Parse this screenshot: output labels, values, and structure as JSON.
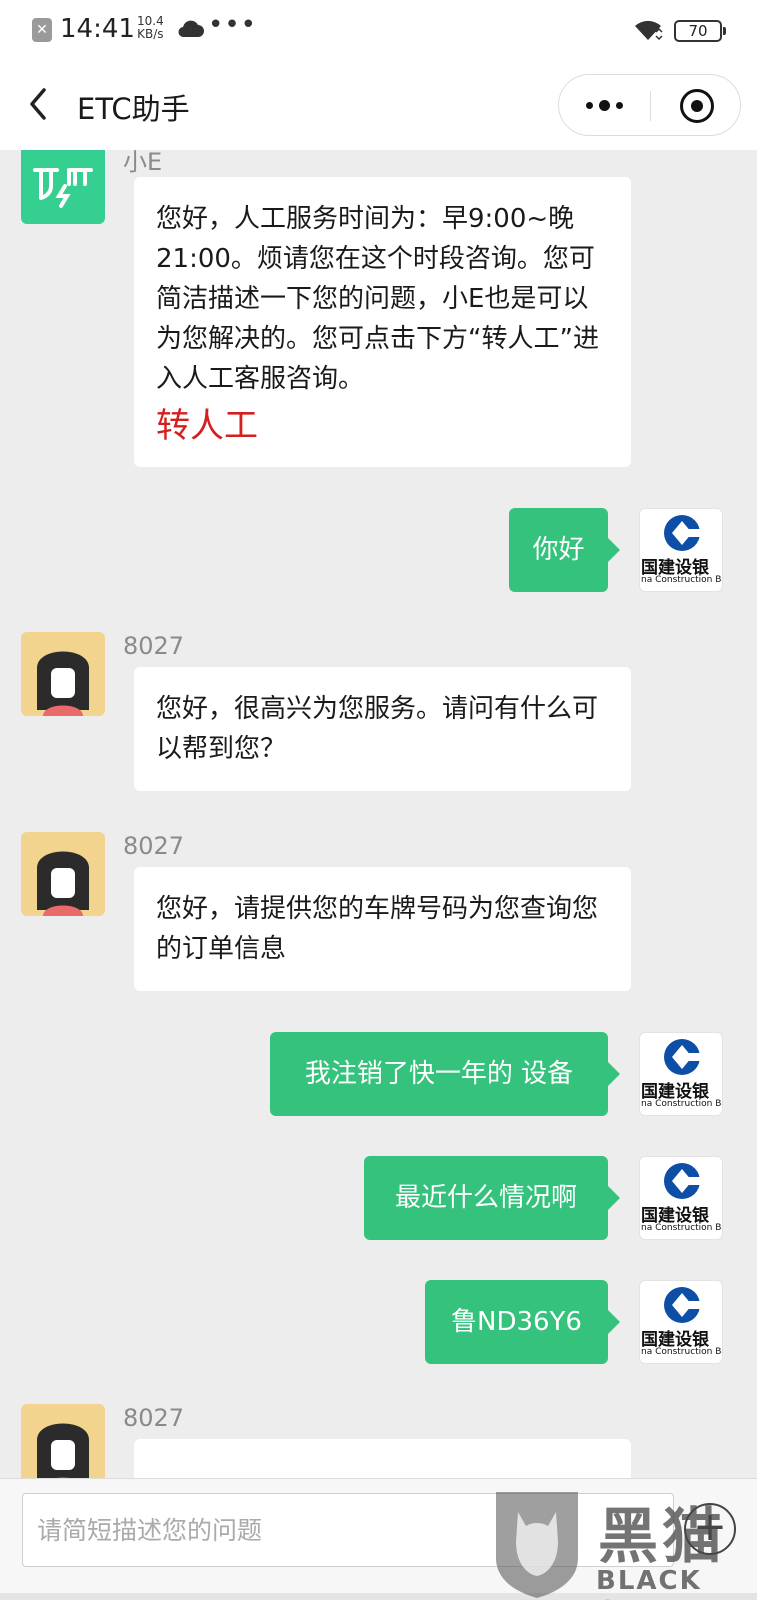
{
  "status_bar": {
    "time": "14:41",
    "net_speed_value": "10.4",
    "net_speed_unit": "KB/s",
    "more": "•••",
    "battery": "70",
    "icons": [
      "close-notification-icon",
      "cloud-icon",
      "wifi-icon",
      "battery-icon"
    ]
  },
  "nav": {
    "back_icon": "chevron-left-icon",
    "title": "ETC助手",
    "capsule_icons": [
      "more-icon",
      "close-circle-icon"
    ]
  },
  "messages": [
    {
      "direction": "in",
      "sender": "小E",
      "avatar": "bot-logo",
      "text": "您好，人工服务时间为：早9:00~晚21:00。烦请您在这个时段咨询。您可简洁描述一下您的问题，小E也是可以为您解决的。您可点击下方“转人工”进入人工客服咨询。",
      "link": "转人工"
    },
    {
      "direction": "out",
      "text": "你好"
    },
    {
      "direction": "in",
      "sender": "8027",
      "avatar": "agent-girl",
      "text": "您好，很高兴为您服务。请问有什么可以帮到您？"
    },
    {
      "direction": "in",
      "sender": "8027",
      "avatar": "agent-girl",
      "text": "您好，请提供您的车牌号码为您查询您的订单信息"
    },
    {
      "direction": "out",
      "text": "我注销了快一年的 设备"
    },
    {
      "direction": "out",
      "text": "最近什么情况啊"
    },
    {
      "direction": "out",
      "text": "鲁ND36Y6"
    },
    {
      "direction": "in",
      "sender": "8027",
      "avatar": "agent-girl",
      "text": ""
    }
  ],
  "user_avatar": {
    "cn": "国建设银",
    "en": "na Construction Ba",
    "accent": "#0d4ea6"
  },
  "input": {
    "placeholder": "请简短描述您的问题",
    "plus": "+"
  },
  "watermark": {
    "cn": "黑猫",
    "en": "BLACK CAT"
  },
  "colors": {
    "outgoing_bubble": "#34c27c",
    "bot_avatar": "#34cf91",
    "link": "#d51f1f",
    "background": "#ededed"
  }
}
